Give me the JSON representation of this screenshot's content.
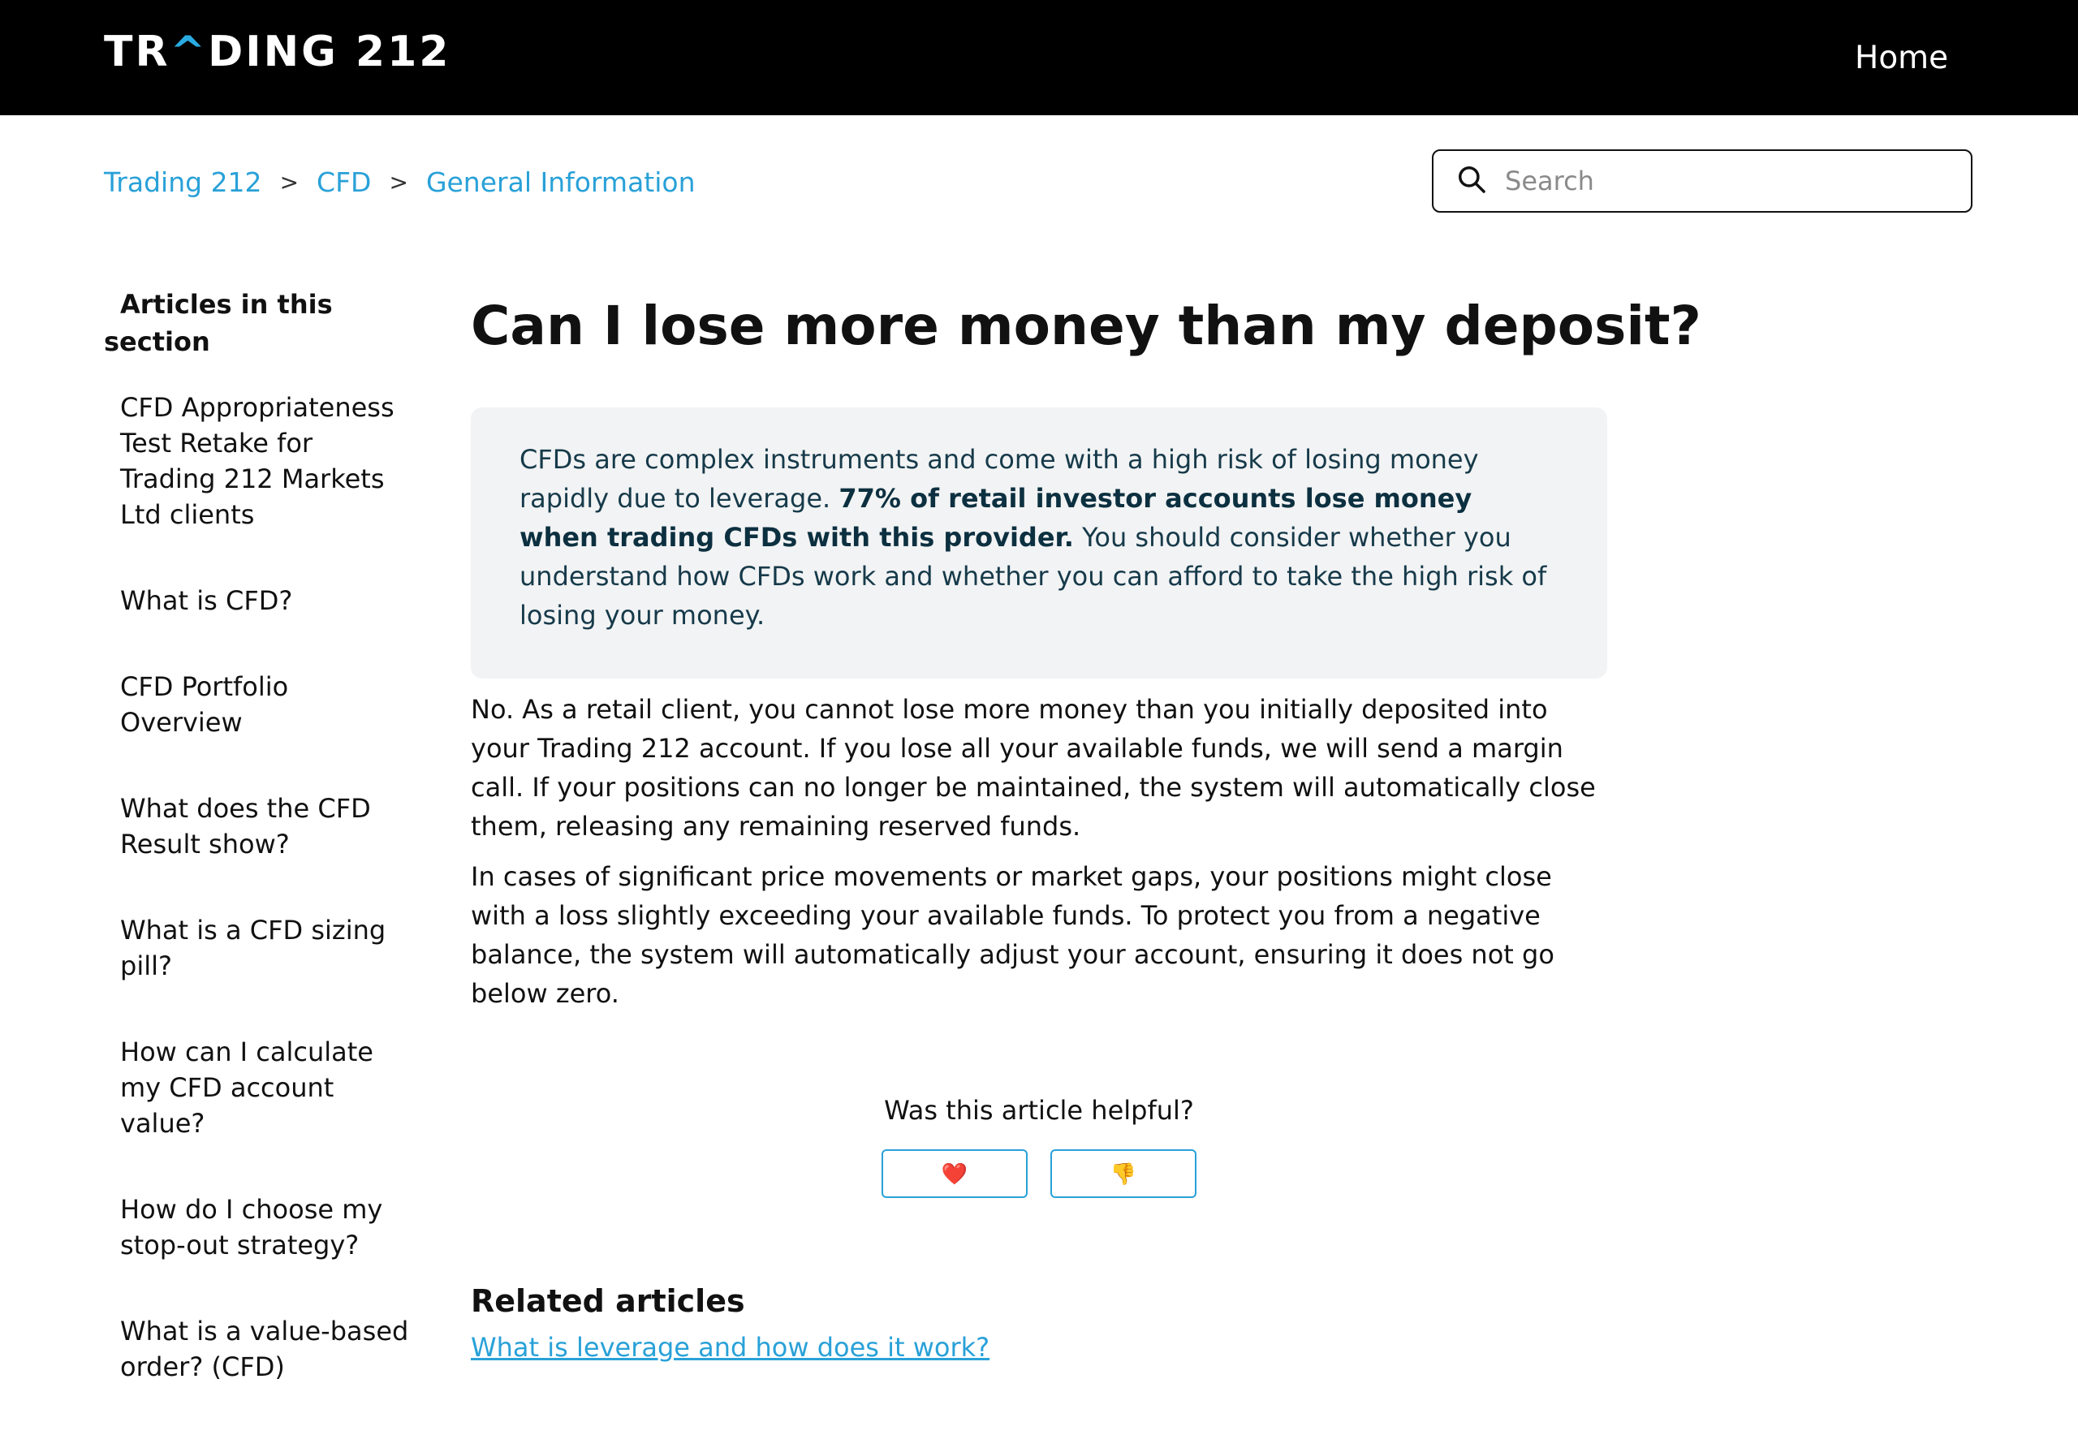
{
  "header": {
    "logo": {
      "part1": "TR",
      "caret": "^",
      "part2": "DING 212"
    },
    "nav_home": "Home"
  },
  "breadcrumb": {
    "items": [
      "Trading 212",
      "CFD",
      "General Information"
    ],
    "separator": ">"
  },
  "search": {
    "placeholder": "Search",
    "value": ""
  },
  "sidebar": {
    "title": "Articles in this section",
    "items": [
      "CFD Appropriateness Test Retake for Trading 212 Markets Ltd clients",
      "What is CFD?",
      "CFD Portfolio Overview",
      "What does the CFD Result show?",
      "What is a CFD sizing pill?",
      "How can I calculate my CFD account value?",
      "How do I choose my stop-out strategy?",
      "What is a value-based order? (CFD)"
    ]
  },
  "article": {
    "title": "Can I lose more money than my deposit?",
    "risk_warning": {
      "pre": "CFDs are complex instruments and come with a high risk of losing money rapidly due to leverage.",
      "bold": "77% of retail investor accounts lose money when trading CFDs with this provider.",
      "post": "You should consider whether you understand how CFDs work and whether you can afford to take the high risk of losing your money."
    },
    "paragraphs": [
      "No. As a retail client, you cannot lose more money than you initially deposited into your Trading 212 account. If you lose all your available funds, we will send a margin call. If your positions can no longer be maintained, the system will automatically close them, releasing any remaining reserved funds.",
      "In cases of significant price movements or market gaps, your positions might close with a loss slightly exceeding your available funds. To protect you from a negative balance, the system will automatically adjust your account, ensuring it does not go below zero."
    ]
  },
  "feedback": {
    "question": "Was this article helpful?",
    "yes_label": "❤️",
    "no_label": "👎"
  },
  "related": {
    "title": "Related articles",
    "links": [
      "What is leverage and how does it work?"
    ]
  },
  "colors": {
    "header_bg": "#000000",
    "accent": "#29a1d8",
    "risk_box_bg": "#f2f3f4"
  }
}
